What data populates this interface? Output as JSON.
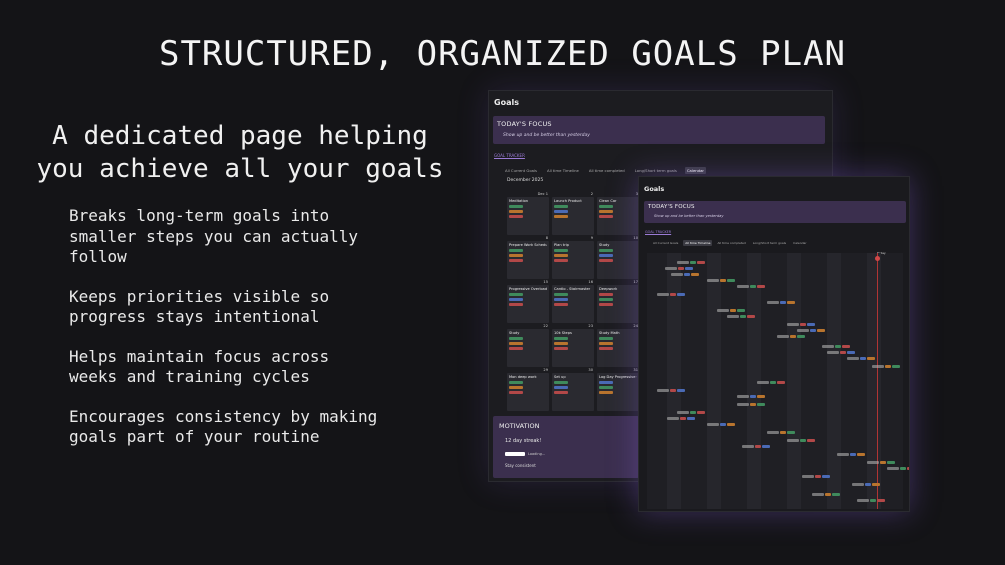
{
  "headline": "STRUCTURED, ORGANIZED GOALS PLAN",
  "subhead": "A dedicated page helping you achieve all your goals",
  "bullets": [
    "Breaks long-term goals into\nsmaller steps you can actually\nfollow",
    "Keeps priorities visible so\nprogress stays intentional",
    "Helps maintain focus across\nweeks and training cycles",
    "Encourages consistency by making\ngoals part of your routine"
  ],
  "calendar_panel": {
    "title": "Goals",
    "focus_title": "TODAY'S FOCUS",
    "focus_subtitle": "Show up and be better than yesterday",
    "tracker_link": "GOAL TRACKER",
    "tabs": [
      "All Current Goals",
      "All time Timeline",
      "All time completed",
      "Long/Short term goals",
      "Calendar"
    ],
    "active_tab": "Calendar",
    "month": "December 2025",
    "days": [
      {
        "num": "Dec 1",
        "title": "Meditation"
      },
      {
        "num": "2",
        "title": "Launch Product"
      },
      {
        "num": "3",
        "title": "Clean Car"
      },
      {
        "num": "8",
        "title": "Prepare Work Schedule"
      },
      {
        "num": "9",
        "title": "Plan trip"
      },
      {
        "num": "10",
        "title": "Study"
      },
      {
        "num": "15",
        "title": "Progressive Overload"
      },
      {
        "num": "16",
        "title": "Cardio - Stairmaster"
      },
      {
        "num": "17",
        "title": "Deepwork"
      },
      {
        "num": "22",
        "title": "Study"
      },
      {
        "num": "23",
        "title": "10k Steps"
      },
      {
        "num": "24",
        "title": "Study Math"
      },
      {
        "num": "29",
        "title": "Mon deep work"
      },
      {
        "num": "30",
        "title": "Set up"
      },
      {
        "num": "31",
        "title": "Log Day Progressive O..."
      }
    ],
    "motivation_title": "MOTIVATION",
    "streak": "12 day streak!",
    "loading": "Loading...",
    "consistent": "Stay consistent"
  },
  "timeline_panel": {
    "title": "Goals",
    "focus_title": "TODAY'S FOCUS",
    "focus_subtitle": "Show up and be better than yesterday",
    "tracker_link": "GOAL TRACKER",
    "tabs": [
      "All Current Goals",
      "All time Timeline",
      "All time completed",
      "Long/Short term goals",
      "Calendar"
    ],
    "active_tab": "All time Timeline",
    "today_label": "Today"
  },
  "colors": {
    "accent_purple": "#3b2f4e",
    "tag_green": "#3f8a5c",
    "tag_orange": "#b8742e",
    "tag_red": "#b24848",
    "tag_blue": "#4a6ab5",
    "today_red": "#d24848"
  }
}
